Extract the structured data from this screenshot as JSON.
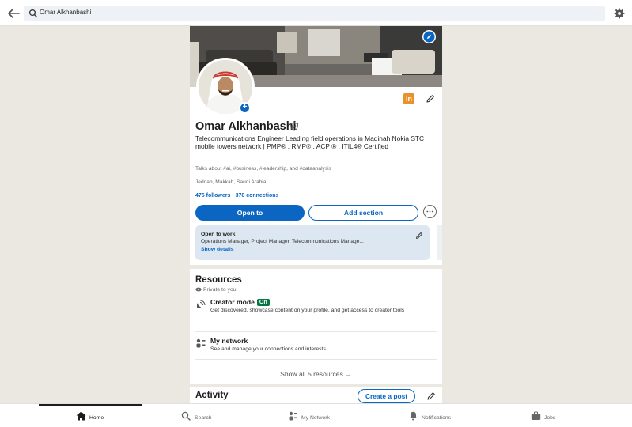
{
  "search": {
    "query": "Omar Alkhanbashi"
  },
  "profile": {
    "name": "Omar Alkhanbashi",
    "headline": "Telecommunications Engineer Leading field operations in Madinah Nokia STC mobile towers network  | PMP® , RMP® , ACP ® , ITIL4® Certified",
    "talks_about": "Talks about #ai, #business, #leadership, and #dataanalysis",
    "location": "Jeddah, Makkah, Saudi Arabia",
    "connections": "475 followers · 370 connections",
    "open_to_label": "Open to",
    "add_section_label": "Add section",
    "open_to_work": {
      "title": "Open to work",
      "roles": "Operations Manager, Project Manager, Telecommunications Manage...",
      "show_details": "Show details"
    }
  },
  "resources": {
    "title": "Resources",
    "privacy": "Private to you",
    "items": [
      {
        "name": "Creator mode",
        "badge": "On",
        "description": "Get discovered, showcase content on your profile, and get access to creator tools"
      },
      {
        "name": "My network",
        "description": "See and manage your connections and interests."
      }
    ],
    "show_all": "Show all 5 resources →"
  },
  "activity": {
    "title": "Activity",
    "create_post_label": "Create a post"
  },
  "bottom_nav": {
    "items": [
      {
        "label": "Home",
        "icon": "home-icon"
      },
      {
        "label": "Search",
        "icon": "search-icon"
      },
      {
        "label": "My Network",
        "icon": "network-icon"
      },
      {
        "label": "Notifications",
        "icon": "bell-icon"
      },
      {
        "label": "Jobs",
        "icon": "briefcase-icon"
      }
    ]
  },
  "colors": {
    "brand_blue": "#0a66c2",
    "creator_on_green": "#057642",
    "page_bg": "#ebe8e2",
    "open_to_work_bg": "#dde7f1"
  }
}
